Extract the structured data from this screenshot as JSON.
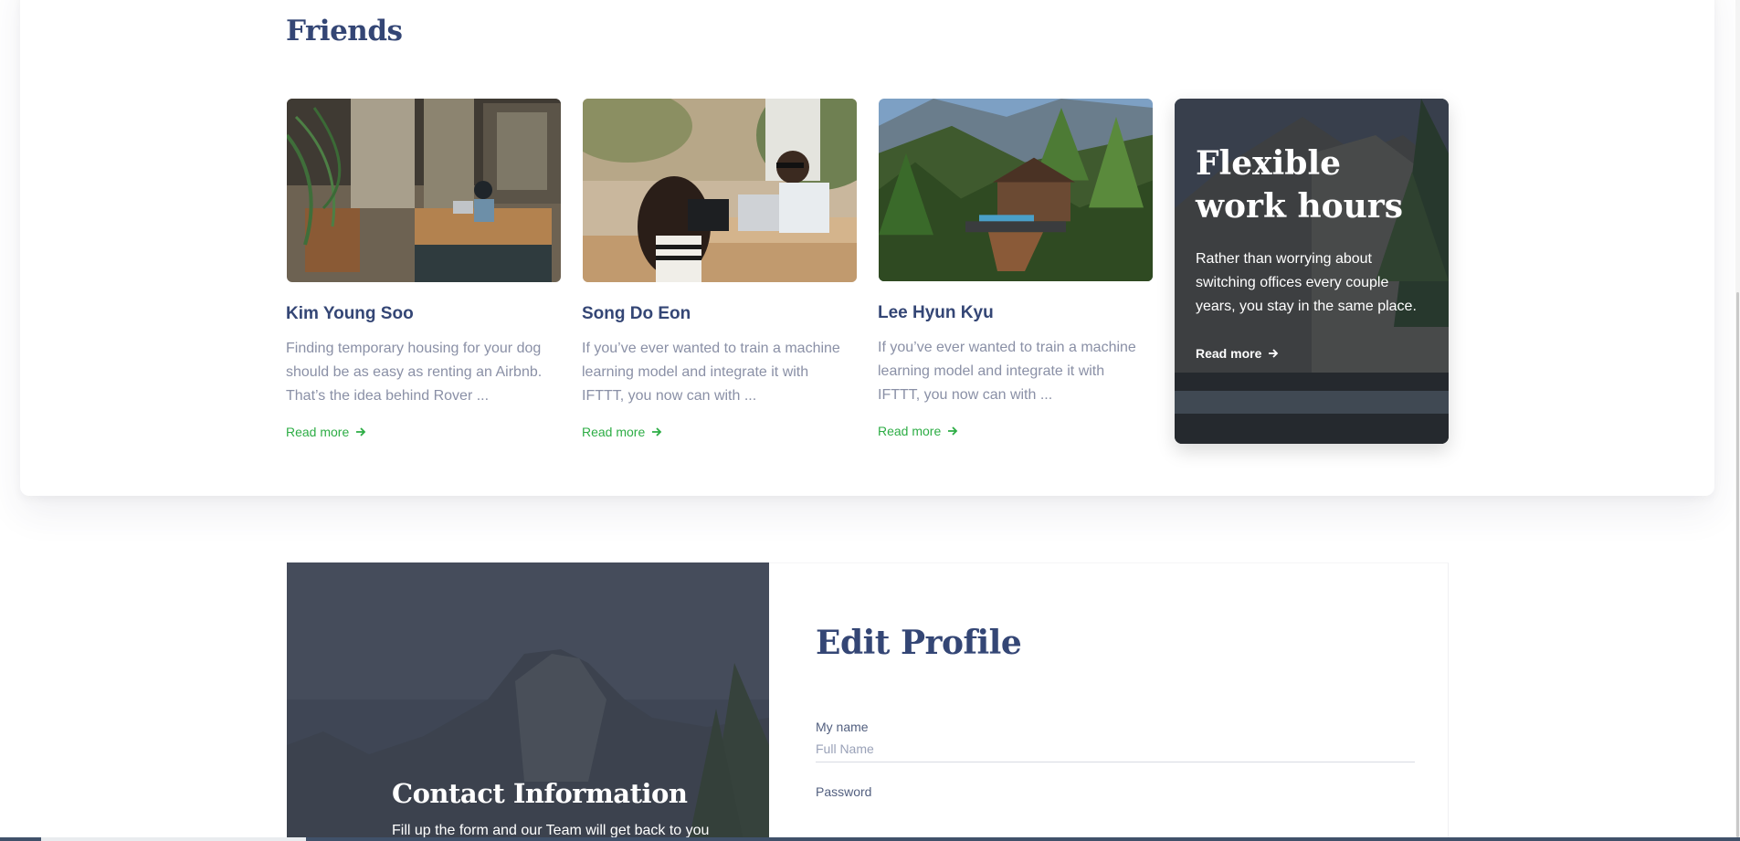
{
  "friends": {
    "title": "Friends",
    "cards": [
      {
        "name": "Kim Young Soo",
        "description": "Finding temporary housing for your dog should be as easy as renting an Airbnb. That’s the idea behind Rover ...",
        "link": "Read more",
        "image": "office-worker-photo"
      },
      {
        "name": "Song Do Eon",
        "description": "If you’ve ever wanted to train a machine learning model and integrate it with IFTTT, you now can with ...",
        "link": "Read more",
        "image": "cafe-meeting-photo"
      },
      {
        "name": "Lee Hyun Kyu",
        "description": "If you’ve ever wanted to train a machine learning model and integrate it with IFTTT, you now can with ...",
        "link": "Read more",
        "image": "forest-cabin-photo"
      }
    ],
    "promo": {
      "title": "Flexible work hours",
      "description": "Rather than worrying about switching offices every couple years, you stay in the same place.",
      "link": "Read more"
    }
  },
  "contact": {
    "title": "Contact Information",
    "description": "Fill up the form and our Team will get back to you"
  },
  "form": {
    "title": "Edit Profile",
    "name_label": "My name",
    "name_placeholder": "Full Name",
    "password_label": "Password"
  },
  "colors": {
    "heading": "#344675",
    "accent_green": "#2dad45",
    "body_text": "#8a90a6"
  }
}
